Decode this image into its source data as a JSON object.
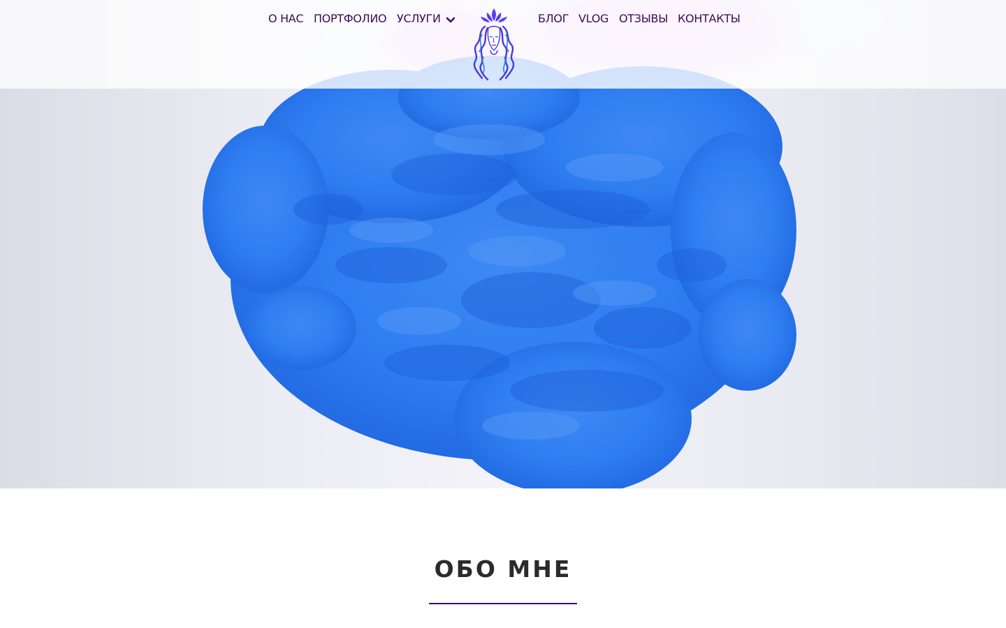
{
  "nav": {
    "left": [
      "О НАС",
      "ПОРТФОЛИО",
      "УСЛУГИ"
    ],
    "right": [
      "БЛОГ",
      "VLOG",
      "ОТЗЫВЫ",
      "КОНТАКТЫ"
    ],
    "dropdown_icon": "chevron-down-icon",
    "color": "#3d0c56"
  },
  "logo": {
    "icon": "woman-face-lotus-logo",
    "color": "#5a3cf0"
  },
  "hero": {
    "image": "blue-ink-cloud-in-water",
    "ink_color": "#2f7ef0"
  },
  "about": {
    "title": "ОБО МНЕ",
    "underline_color": "#3d0c56"
  }
}
